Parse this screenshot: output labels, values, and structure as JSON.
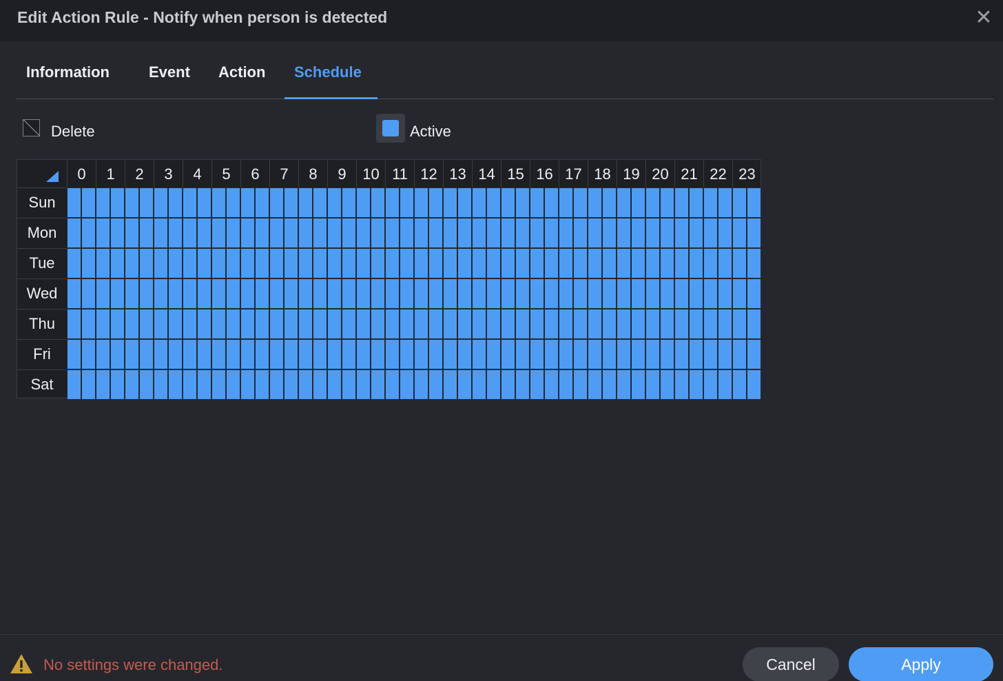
{
  "dialog": {
    "title": "Edit Action Rule - Notify when person is detected",
    "close_icon": "close-icon"
  },
  "tabs": [
    {
      "label": "Information",
      "active": false
    },
    {
      "label": "Event",
      "active": false
    },
    {
      "label": "Action",
      "active": false
    },
    {
      "label": "Schedule",
      "active": true
    }
  ],
  "legend": {
    "delete_label": "Delete",
    "active_label": "Active"
  },
  "schedule": {
    "hours": [
      "0",
      "1",
      "2",
      "3",
      "4",
      "5",
      "6",
      "7",
      "8",
      "9",
      "10",
      "11",
      "12",
      "13",
      "14",
      "15",
      "16",
      "17",
      "18",
      "19",
      "20",
      "21",
      "22",
      "23"
    ],
    "days": [
      "Sun",
      "Mon",
      "Tue",
      "Wed",
      "Thu",
      "Fri",
      "Sat"
    ],
    "slots_per_hour": 2,
    "all_active": true
  },
  "footer": {
    "status_text": "No settings were changed.",
    "warning_icon": "warning-icon",
    "cancel_label": "Cancel",
    "apply_label": "Apply"
  },
  "colors": {
    "accent": "#4f9cf4",
    "warning_text": "#c75a4f",
    "warning_icon": "#c8a03a"
  }
}
